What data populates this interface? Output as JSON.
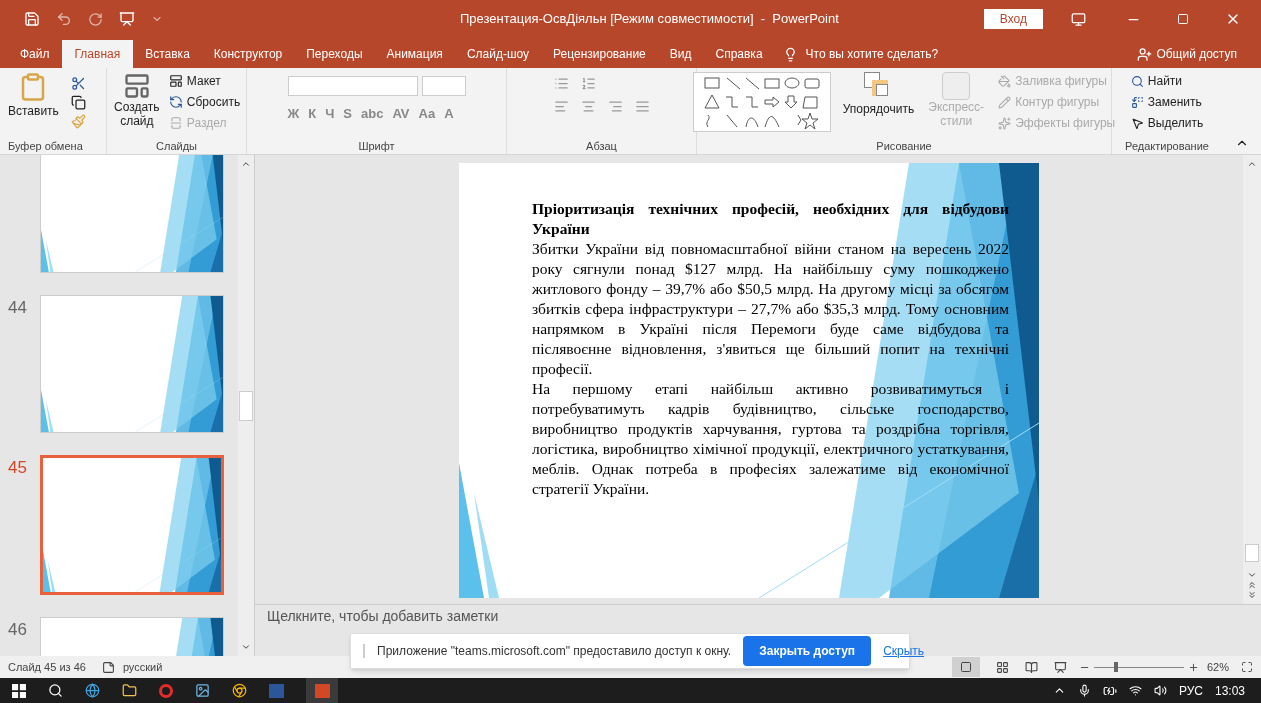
{
  "window": {
    "title": "Презентация-ОсвДіяльн [Режим совместимости]  -  PowerPoint",
    "signin": "Вход"
  },
  "menu_tabs": [
    {
      "label": "Файл",
      "selected": false
    },
    {
      "label": "Главная",
      "selected": true
    },
    {
      "label": "Вставка",
      "selected": false
    },
    {
      "label": "Конструктор",
      "selected": false
    },
    {
      "label": "Переходы",
      "selected": false
    },
    {
      "label": "Анимация",
      "selected": false
    },
    {
      "label": "Слайд-шоу",
      "selected": false
    },
    {
      "label": "Рецензирование",
      "selected": false
    },
    {
      "label": "Вид",
      "selected": false
    },
    {
      "label": "Справка",
      "selected": false
    }
  ],
  "tell_me": "Что вы хотите сделать?",
  "share": "Общий доступ",
  "ribbon": {
    "clipboard": {
      "paste": "Вставить",
      "label": "Буфер обмена"
    },
    "slides": {
      "new_slide": "Создать слайд",
      "layout": "Макет",
      "reset": "Сбросить",
      "section": "Раздел",
      "label": "Слайды"
    },
    "font": {
      "buttons": [
        "Ж",
        "К",
        "Ч",
        "S",
        "abc",
        "AV",
        "Aa",
        "A"
      ],
      "label": "Шрифт"
    },
    "paragraph": {
      "label": "Абзац"
    },
    "drawing": {
      "arrange": "Упорядочить",
      "quick_styles": "Экспресс-стили",
      "fill": "Заливка фигуры",
      "outline": "Контур фигуры",
      "effects": "Эффекты фигуры",
      "label": "Рисование"
    },
    "editing": {
      "find": "Найти",
      "replace": "Заменить",
      "select": "Выделить",
      "label": "Редактирование"
    }
  },
  "thumbnails": [
    {
      "selected": false
    },
    {
      "number": "44",
      "selected": false
    },
    {
      "number": "45",
      "selected": true
    },
    {
      "number": "46",
      "selected": false
    }
  ],
  "slide": {
    "title": "Пріоритизація технічних професій, необхідних для відбудови України",
    "paragraphs": [
      "Збитки України від повномасштабної війни станом на вересень 2022 року сягнули понад $127 млрд. На найбільшу суму пошкоджено житлового фонду – 39,7% або $50,5 млрд. На другому місці за обсягом збитків сфера інфраструктури – 27,7% або $35,3 млрд. Тому основним напрямком в Україні після Перемоги буде саме відбудова та післявоєнне відновлення, з'явиться ще більший попит на технічні професії.",
      "На першому етапі найбільш активно розвиватимуться і потребуватимуть кадрів будівництво, сільське господарство, виробництво продуктів харчування, гуртова та роздрібна торгівля, логістика, виробництво хімічної продукції, електричного устаткування, меблів. Однак потреба в професіях залежатиме від економічної стратегії України."
    ]
  },
  "notes_placeholder": "Щелкните, чтобы добавить заметки",
  "toast": {
    "message": "Приложение \"teams.microsoft.com\" предоставило доступ к окну.",
    "button": "Закрыть доступ",
    "link": "Скрыть"
  },
  "status_bar": {
    "slide": "Слайд 45 из 46",
    "language": "русский",
    "zoom_slider": {
      "level": 0.22
    },
    "zoom": "62%"
  },
  "taskbar": {
    "language": "РУС",
    "time": "13:03"
  }
}
